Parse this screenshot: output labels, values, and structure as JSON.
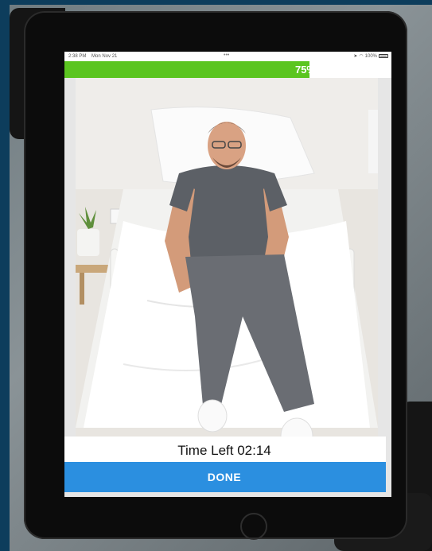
{
  "status_bar": {
    "time": "2:38 PM",
    "date": "Mon Nov 21",
    "dots": "•••",
    "signal_icon": "location-arrow-icon",
    "wifi_icon": "wifi-icon",
    "battery_level": "100%",
    "battery_icon": "battery-icon"
  },
  "progress": {
    "percent": 75,
    "label": "75%",
    "fill_color": "#5bc520"
  },
  "video": {
    "subject": "exercise-demo-photo"
  },
  "timer": {
    "label": "Time Left 02:14"
  },
  "actions": {
    "done_label": "DONE",
    "done_color": "#2b8fe0"
  }
}
